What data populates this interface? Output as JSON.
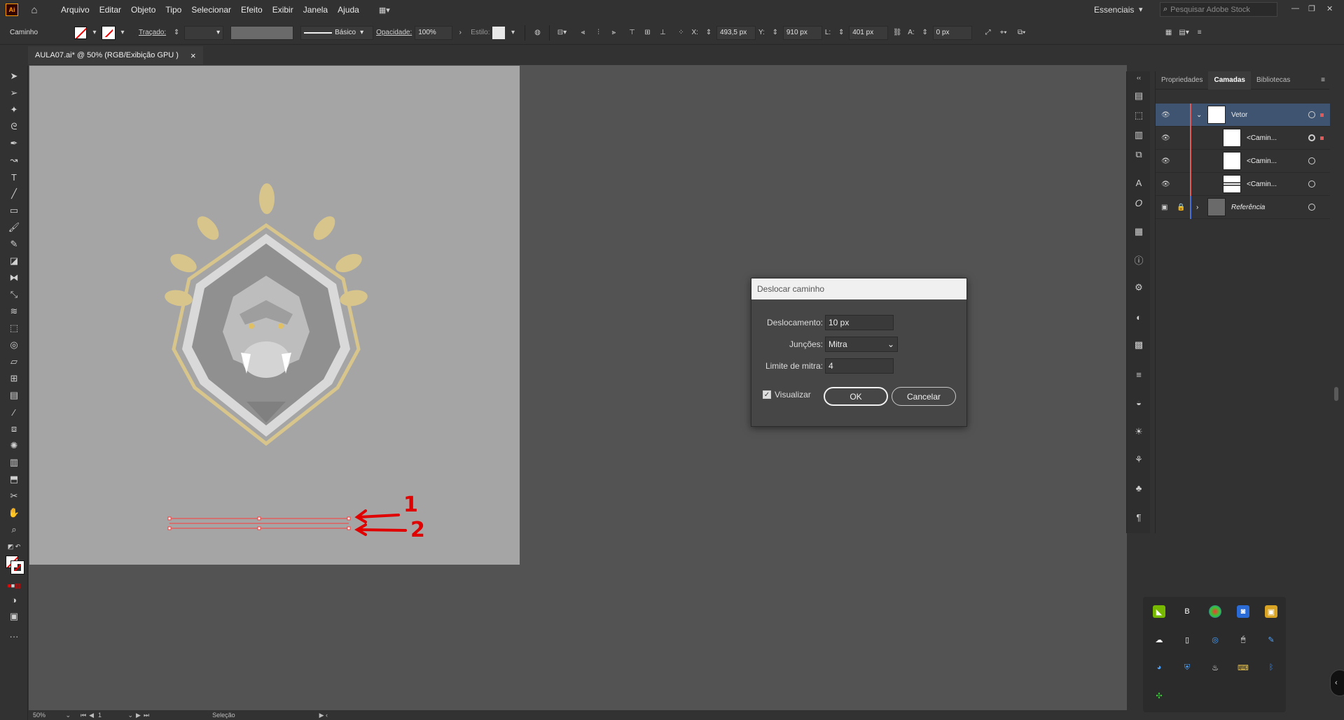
{
  "menubar": {
    "app_icon": "Ai",
    "items": [
      "Arquivo",
      "Editar",
      "Objeto",
      "Tipo",
      "Selecionar",
      "Efeito",
      "Exibir",
      "Janela",
      "Ajuda"
    ],
    "workspace": "Essenciais",
    "search_placeholder": "Pesquisar Adobe Stock"
  },
  "controlbar": {
    "selection_type": "Caminho",
    "stroke_label": "Traçado:",
    "stroke_style": "Básico",
    "opacity_label": "Opacidade:",
    "opacity_value": "100%",
    "style_label": "Estilo:",
    "x_label": "X:",
    "x_value": "493,5 px",
    "y_label": "Y:",
    "y_value": "910 px",
    "w_label": "L:",
    "w_value": "401 px",
    "h_label": "A:",
    "h_value": "0 px"
  },
  "document": {
    "tab_title": "AULA07.ai* @ 50% (RGB/Exibição GPU )",
    "close": "×"
  },
  "annotations": {
    "label_1": "1",
    "label_2": "2"
  },
  "dialog": {
    "title": "Deslocar caminho",
    "offset_label": "Deslocamento:",
    "offset_value": "10 px",
    "joins_label": "Junções:",
    "joins_value": "Mitra",
    "miter_label": "Limite de mitra:",
    "miter_value": "4",
    "preview_label": "Visualizar",
    "preview_checked": true,
    "ok_label": "OK",
    "cancel_label": "Cancelar"
  },
  "panel": {
    "tabs": [
      "Propriedades",
      "Camadas",
      "Bibliotecas"
    ],
    "active_tab": "Camadas",
    "layers": [
      {
        "name": "Vetor",
        "color": "#e05a5a"
      },
      {
        "name": "<Camin...",
        "color": "#e05a5a"
      },
      {
        "name": "<Camin...",
        "color": "#e05a5a"
      },
      {
        "name": "<Camin...",
        "color": "#e05a5a"
      },
      {
        "name": "Referência",
        "color": "#4a6fd9"
      }
    ]
  },
  "statusbar": {
    "zoom": "50%",
    "page": "1",
    "tool": "Seleção"
  },
  "colors": {
    "accent_selection": "#3e5470",
    "path_highlight": "#ff3b3b",
    "annotation_red": "#e00000",
    "logo_gold": "#d8c58c"
  }
}
